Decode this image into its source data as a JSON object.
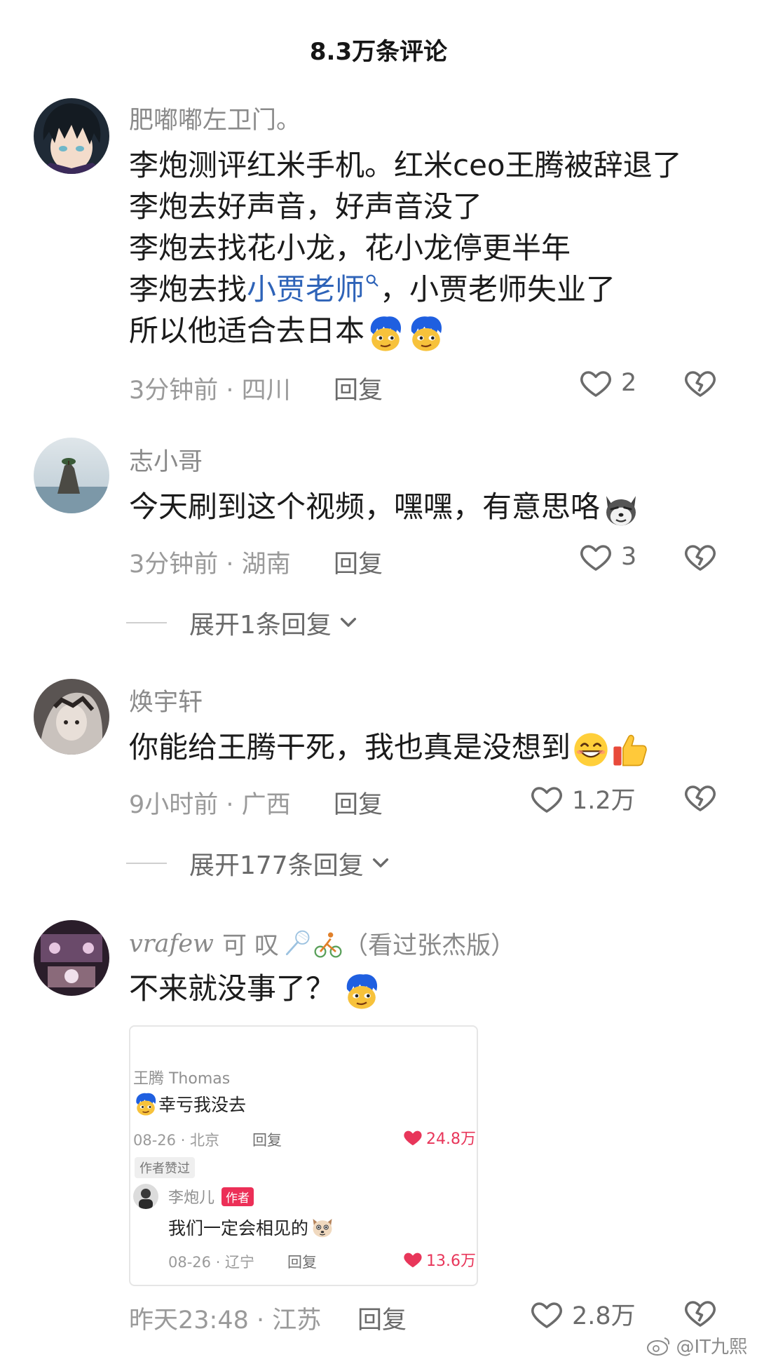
{
  "header": {
    "title": "8.3万条评论"
  },
  "comments": [
    {
      "username": "肥嘟嘟左卫门。",
      "lines": [
        "李炮测评红米手机。红米ceo王腾被辞退了",
        "李炮去好声音，好声音没了",
        "李炮去找花小龙，花小龙停更半年"
      ],
      "line4_pre": "李炮去找",
      "line4_link": "小贾老师",
      "line4_post": "，小贾老师失业了",
      "line5": "所以他适合去日本",
      "meta": "3分钟前 · 四川",
      "reply": "回复",
      "likes": "2"
    },
    {
      "username": "志小哥",
      "text": "今天刷到这个视频，嘿嘿，有意思咯",
      "meta": "3分钟前 · 湖南",
      "reply": "回复",
      "likes": "3",
      "expand": "展开1条回复"
    },
    {
      "username": "焕宇轩",
      "text": "你能给王腾干死，我也真是没想到",
      "meta": "9小时前 · 广西",
      "reply": "回复",
      "likes": "1.2万",
      "expand": "展开177条回复"
    },
    {
      "username_script": "vrafew",
      "username": "可 叹",
      "username_suffix": "（看过张杰版）",
      "text": "不来就没事了？",
      "meta": "昨天23:48 · 江苏",
      "reply": "回复",
      "likes": "2.8万",
      "quote": {
        "name": "王腾 Thomas",
        "text": "幸亏我没去",
        "meta": "08-26 · 北京",
        "reply": "回复",
        "likes": "24.8万",
        "badge": "作者赞过",
        "sub_name": "李炮儿",
        "sub_badge": "作者",
        "sub_text": "我们一定会相见的",
        "sub_meta": "08-26 · 辽宁",
        "sub_reply": "回复",
        "sub_likes": "13.6万"
      }
    }
  ],
  "watermark": "@IT九熙",
  "colors": {
    "link": "#2e63b8",
    "author_badge": "#ec2f57",
    "like_red": "#e8365a"
  }
}
